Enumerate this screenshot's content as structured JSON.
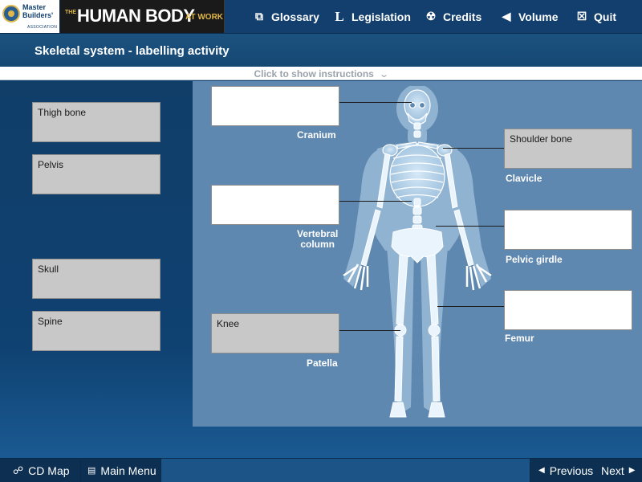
{
  "logo": {
    "line1": "Master",
    "line2": "Builders'",
    "sub": "ASSOCIATION"
  },
  "brand": {
    "prefix": "THE",
    "main": "HUMAN BODY",
    "accent": "AT WORK"
  },
  "nav": [
    {
      "label": "Glossary",
      "icon": "glossary-icon",
      "glyph": "⧉"
    },
    {
      "label": "Legislation",
      "icon": "legislation-icon",
      "glyph": "L"
    },
    {
      "label": "Credits",
      "icon": "credits-icon",
      "glyph": "☢"
    },
    {
      "label": "Volume",
      "icon": "volume-icon",
      "glyph": "◀"
    },
    {
      "label": "Quit",
      "icon": "quit-icon",
      "glyph": "☒"
    }
  ],
  "page_title": "Skeletal system - labelling activity",
  "instructions": {
    "text": "Click to show instructions",
    "icon": "chevron-down-icon"
  },
  "answers": [
    "Thigh bone",
    "Pelvis",
    "Skull",
    "Spine"
  ],
  "targets": {
    "cranium": {
      "label": "Cranium",
      "value": ""
    },
    "clavicle": {
      "label": "Clavicle",
      "value": "Shoulder bone"
    },
    "vertebral": {
      "label": "Vertebral column",
      "line1": "Vertebral",
      "line2": "column",
      "value": ""
    },
    "pelvic": {
      "label": "Pelvic girdle",
      "value": ""
    },
    "patella": {
      "label": "Patella",
      "value": "Knee"
    },
    "femur": {
      "label": "Femur",
      "value": ""
    }
  },
  "footer": {
    "cd_map": "CD Map",
    "main_menu": "Main Menu",
    "previous": "Previous",
    "next": "Next"
  },
  "colors": {
    "header": "#123f6d",
    "title_band": "#1c527f",
    "board": "#5f88b0",
    "answer_box": "#c8c8c8",
    "target_box": "#ffffff",
    "accent": "#e0b84a"
  }
}
